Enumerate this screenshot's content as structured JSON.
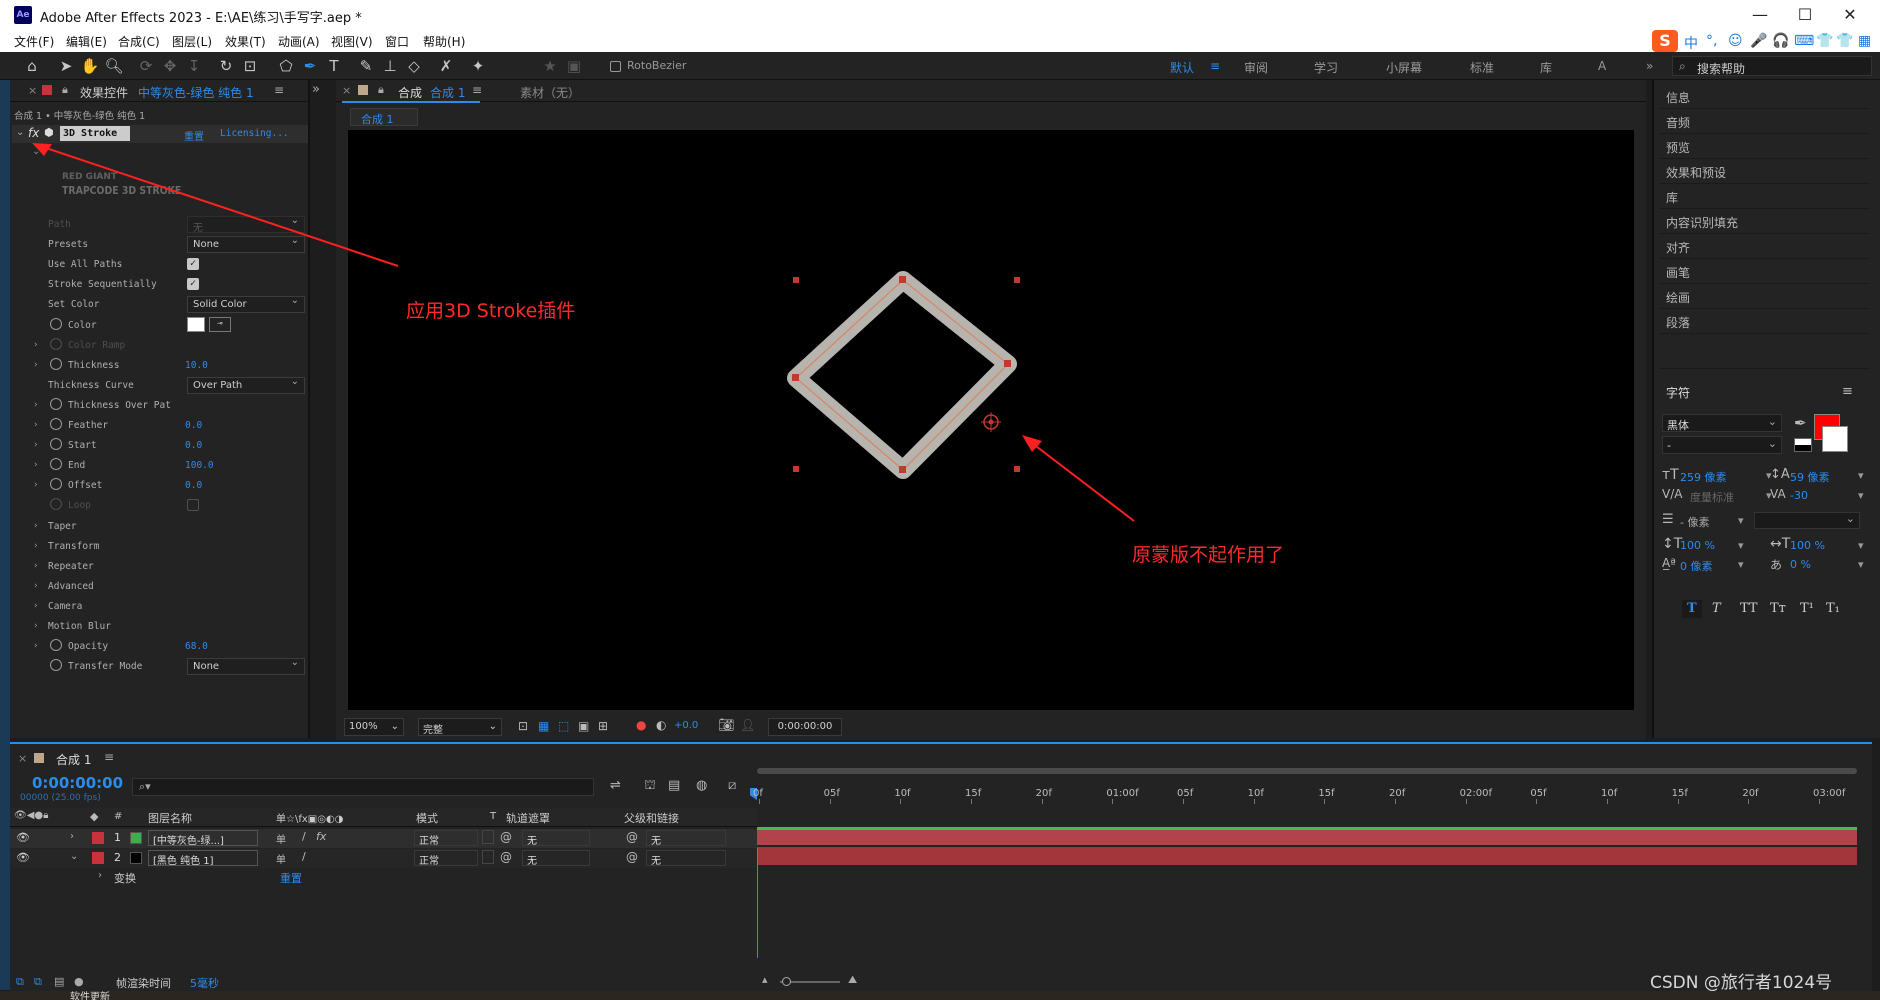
{
  "window": {
    "logo": "Ae",
    "title": "Adobe After Effects 2023 - E:\\AE\\练习\\手写字.aep *",
    "minimize": "—",
    "maximize": "☐",
    "close": "✕"
  },
  "menu": [
    "文件(F)",
    "编辑(E)",
    "合成(C)",
    "图层(L)",
    "效果(T)",
    "动画(A)",
    "视图(V)",
    "窗口",
    "帮助(H)"
  ],
  "ime": {
    "label": "中",
    "icons": [
      "°,",
      "☺",
      "🎤",
      "🎧",
      "⌨",
      "👕",
      "👕",
      "▦"
    ]
  },
  "toolbar": {
    "rotobezier_label": "RotoBezier",
    "workspaces": [
      "默认",
      "审阅",
      "学习",
      "小屏幕",
      "标准",
      "库",
      "A"
    ],
    "search_placeholder": "搜索帮助"
  },
  "effect_panel": {
    "tab_label": "效果控件",
    "tab_layer": "中等灰色-绿色 纯色 1",
    "breadcrumb": "合成 1 • 中等灰色-绿色 纯色 1",
    "fx_label": "fx",
    "effect_name": "3D Stroke",
    "reset": "重置",
    "licensing": "Licensing...",
    "brand_line1": "RED GIANT",
    "brand_line2": "TRAPCODE 3D STROKE",
    "properties": [
      {
        "name": "Path",
        "value": "无",
        "kind": "dropdown",
        "dim": true
      },
      {
        "name": "Presets",
        "value": "None",
        "kind": "dropdown"
      },
      {
        "name": "Use All Paths",
        "value": "✓",
        "kind": "checkbox"
      },
      {
        "name": "Stroke Sequentially",
        "value": "✓",
        "kind": "checkbox"
      },
      {
        "name": "Set Color",
        "value": "Solid Color",
        "kind": "dropdown"
      },
      {
        "name": "Color",
        "value": "",
        "kind": "color",
        "stopwatch": true
      },
      {
        "name": "Color Ramp",
        "value": "",
        "kind": "none",
        "stopwatch": true,
        "arrow": true,
        "dim": true
      },
      {
        "name": "Thickness",
        "value": "10.0",
        "kind": "number",
        "stopwatch": true,
        "arrow": true
      },
      {
        "name": "Thickness Curve",
        "value": "Over Path",
        "kind": "dropdown"
      },
      {
        "name": "Thickness Over Pat",
        "value": "",
        "kind": "none",
        "stopwatch": true,
        "arrow": true
      },
      {
        "name": "Feather",
        "value": "0.0",
        "kind": "number",
        "stopwatch": true,
        "arrow": true
      },
      {
        "name": "Start",
        "value": "0.0",
        "kind": "number",
        "stopwatch": true,
        "arrow": true
      },
      {
        "name": "End",
        "value": "100.0",
        "kind": "number",
        "stopwatch": true,
        "arrow": true
      },
      {
        "name": "Offset",
        "value": "0.0",
        "kind": "number",
        "stopwatch": true,
        "arrow": true
      },
      {
        "name": "Loop",
        "value": "",
        "kind": "checkbox-empty",
        "stopwatch": true,
        "dim": true
      },
      {
        "name": "Taper",
        "value": "",
        "kind": "group",
        "arrow": true
      },
      {
        "name": "Transform",
        "value": "",
        "kind": "group",
        "arrow": true
      },
      {
        "name": "Repeater",
        "value": "",
        "kind": "group",
        "arrow": true
      },
      {
        "name": "Advanced",
        "value": "",
        "kind": "group",
        "arrow": true
      },
      {
        "name": "Camera",
        "value": "",
        "kind": "group",
        "arrow": true
      },
      {
        "name": "Motion Blur",
        "value": "",
        "kind": "group",
        "arrow": true
      },
      {
        "name": "Opacity",
        "value": "68.0",
        "kind": "number",
        "stopwatch": true,
        "arrow": true
      },
      {
        "name": "Transfer Mode",
        "value": "None",
        "kind": "dropdown",
        "stopwatch": true
      }
    ]
  },
  "comp_panel": {
    "tab_label": "合成",
    "tab_name": "合成 1",
    "footage_label": "素材（无）",
    "subtab": "合成 1",
    "zoom": "100%",
    "quality": "完整",
    "exposure": "+0.0",
    "timecode": "0:00:00:00"
  },
  "right_panel": {
    "items": [
      "信息",
      "音频",
      "预览",
      "效果和预设",
      "库",
      "内容识别填充",
      "对齐",
      "画笔",
      "绘画",
      "段落"
    ],
    "character_title": "字符",
    "font": "黑体",
    "style": "-",
    "font_size": "259 像素",
    "leading": "59 像素",
    "kerning": "度量标准",
    "tracking": "-30",
    "stroke_width": "- 像素",
    "vscale": "100 %",
    "hscale": "100 %",
    "baseline": "0 像素",
    "tsume": "0 %",
    "text_styles": [
      "T",
      "T",
      "TT",
      "Tт",
      "T¹",
      "T₁"
    ],
    "fill_color": "#ff0000"
  },
  "timeline": {
    "tab": "合成 1",
    "timecode": "0:00:00:00",
    "fps": "00000 (25.00 fps)",
    "columns": {
      "num": "#",
      "name": "图层名称",
      "switches": "单☆\\fx▣◎◐◑",
      "mode": "模式",
      "t": "T",
      "matte": "轨道遮罩",
      "parent": "父级和链接"
    },
    "layers": [
      {
        "num": "1",
        "name": "[中等灰色-绿...]",
        "color": "#3cb04a",
        "mode": "正常",
        "matte": "无",
        "parent": "无",
        "fx": "fx"
      },
      {
        "num": "2",
        "name": "[黑色 纯色 1]",
        "color": "#000000",
        "mode": "正常",
        "matte": "无",
        "parent": "无",
        "fx": ""
      }
    ],
    "transform_label": "变换",
    "transform_reset": "重置",
    "ruler": [
      "0f",
      "05f",
      "10f",
      "15f",
      "20f",
      "01:00f",
      "05f",
      "10f",
      "15f",
      "20f",
      "02:00f",
      "05f",
      "10f",
      "15f",
      "20f",
      "03:00f"
    ]
  },
  "status": {
    "render_label": "帧渲染时间",
    "render_value": "5毫秒"
  },
  "annotations": {
    "apply_plugin": "应用3D Stroke插件",
    "mask_broken": "原蒙版不起作用了"
  },
  "watermark": "CSDN @旅行者1024号",
  "taskbar_hint": "软件更新"
}
